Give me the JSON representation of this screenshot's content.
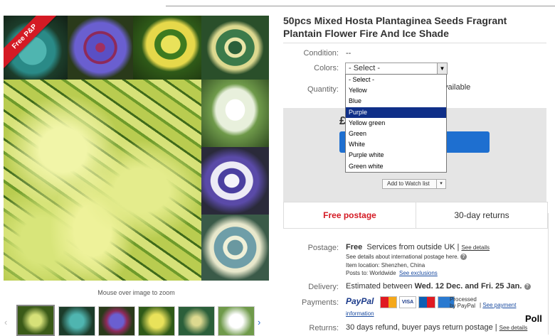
{
  "gallery": {
    "ribbon": "Free P&P",
    "zoom_hint": "Mouse over image to zoom"
  },
  "product": {
    "title": "50pcs Mixed Hosta Plantaginea Seeds Fragrant Plantain Flower Fire And Ice Shade"
  },
  "details": {
    "condition_label": "Condition:",
    "condition_value": "--",
    "colors_label": "Colors:",
    "colors_selected": "- Select -",
    "quantity_label": "Quantity:",
    "available_text": "vailable",
    "price_symbol": "£"
  },
  "dropdown": {
    "options": [
      "- Select -",
      "Yellow",
      "Blue",
      "Purple",
      "Yellow green",
      "Green",
      "White",
      "Purple white",
      "Green white"
    ],
    "highlighted": "Purple"
  },
  "watch": {
    "label": "Add to Watch list",
    "caret": "▾"
  },
  "shipping_tabs": {
    "free_postage": "Free postage",
    "returns": "30-day returns"
  },
  "postage": {
    "label": "Postage:",
    "free": "Free",
    "services": "Services from outside UK |",
    "see_details": "See details",
    "intl_note": "See details about international postage here.",
    "item_location": "Item location:  Shenzhen, China",
    "posts_to": "Posts to:  Worldwide",
    "see_exclusions": "See exclusions"
  },
  "delivery": {
    "label": "Delivery:",
    "prefix": "Estimated between",
    "dates": "Wed. 12 Dec. and Fri. 25 Jan."
  },
  "payments": {
    "label": "Payments:",
    "paypal": "PayPal",
    "processed": "Processed",
    "by_paypal": "by PayPal",
    "see_payment": "See payment",
    "information": "information",
    "cards": [
      "MasterCard",
      "VISA",
      "Maestro",
      "AMEX"
    ]
  },
  "returns": {
    "label": "Returns:",
    "text": "30 days refund, buyer pays return postage |",
    "see_details": "See details"
  },
  "poll": "Poll",
  "colors": {
    "accent_blue": "#1e6fd0",
    "free_red": "#d41a24",
    "dropdown_highlight": "#0f2f88"
  }
}
